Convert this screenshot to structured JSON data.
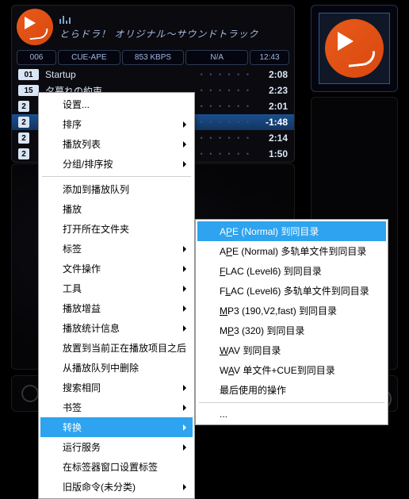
{
  "header": {
    "title": "とらドラ！ オリジナル～サウンドトラック"
  },
  "infobar": {
    "index": "006",
    "codec": "CUE-APE",
    "bitrate": "853 KBPS",
    "status": "N/A",
    "clock": "12:43"
  },
  "tracks": [
    {
      "num": "01",
      "title": "Startup",
      "time": "2:08",
      "sel": false,
      "cut": false
    },
    {
      "num": "15",
      "title": "夕暮れの約束",
      "time": "2:23",
      "sel": false,
      "cut": false
    },
    {
      "num": "2",
      "title": "",
      "time": "2:01",
      "sel": false,
      "cut": true
    },
    {
      "num": "2",
      "title": "",
      "time": "-1:48",
      "sel": true,
      "cut": true
    },
    {
      "num": "2",
      "title": "",
      "time": "2:14",
      "sel": false,
      "cut": true
    },
    {
      "num": "2",
      "title": "",
      "time": "1:50",
      "sel": false,
      "cut": true
    }
  ],
  "menu1": [
    {
      "label": "设置...",
      "sub": false
    },
    {
      "label": "排序",
      "sub": true
    },
    {
      "label": "播放列表",
      "sub": true
    },
    {
      "label": "分组/排序按",
      "sub": true
    },
    {
      "sep": true
    },
    {
      "label": "添加到播放队列",
      "sub": false
    },
    {
      "label": "播放",
      "sub": false
    },
    {
      "label": "打开所在文件夹",
      "sub": false
    },
    {
      "label": "标签",
      "sub": true
    },
    {
      "label": "文件操作",
      "sub": true
    },
    {
      "label": "工具",
      "sub": true
    },
    {
      "label": "播放增益",
      "sub": true
    },
    {
      "label": "播放统计信息",
      "sub": true
    },
    {
      "label": "放置到当前正在播放项目之后",
      "sub": false
    },
    {
      "label": "从播放队列中删除",
      "sub": false
    },
    {
      "label": "搜索相同",
      "sub": true
    },
    {
      "label": "书签",
      "sub": true
    },
    {
      "label": "转换",
      "sub": true,
      "sel": true
    },
    {
      "label": "运行服务",
      "sub": true
    },
    {
      "label": "在标签器窗口设置标签",
      "sub": false
    },
    {
      "label": "旧版命令(未分类)",
      "sub": true
    }
  ],
  "menu2": [
    {
      "pre": "A",
      "u": "P",
      "post": "E (Normal) 到同目录",
      "sel": true
    },
    {
      "pre": "A",
      "u": "P",
      "post": "E (Normal) 多轨单文件到同目录"
    },
    {
      "pre": "",
      "u": "F",
      "post": "LAC (Level6) 到同目录"
    },
    {
      "pre": "F",
      "u": "L",
      "post": "AC (Level6) 多轨单文件到同目录"
    },
    {
      "pre": "",
      "u": "M",
      "post": "P3 (190,V2,fast) 到同目录"
    },
    {
      "pre": "M",
      "u": "P",
      "post": "3 (320) 到同目录"
    },
    {
      "pre": "",
      "u": "W",
      "post": "AV 到同目录"
    },
    {
      "pre": "W",
      "u": "A",
      "post": "V 单文件+CUE到同目录"
    },
    {
      "pre": "最后使用的操作",
      "u": "",
      "post": ""
    },
    {
      "sep": true
    },
    {
      "pre": "...",
      "u": "",
      "post": ""
    }
  ]
}
